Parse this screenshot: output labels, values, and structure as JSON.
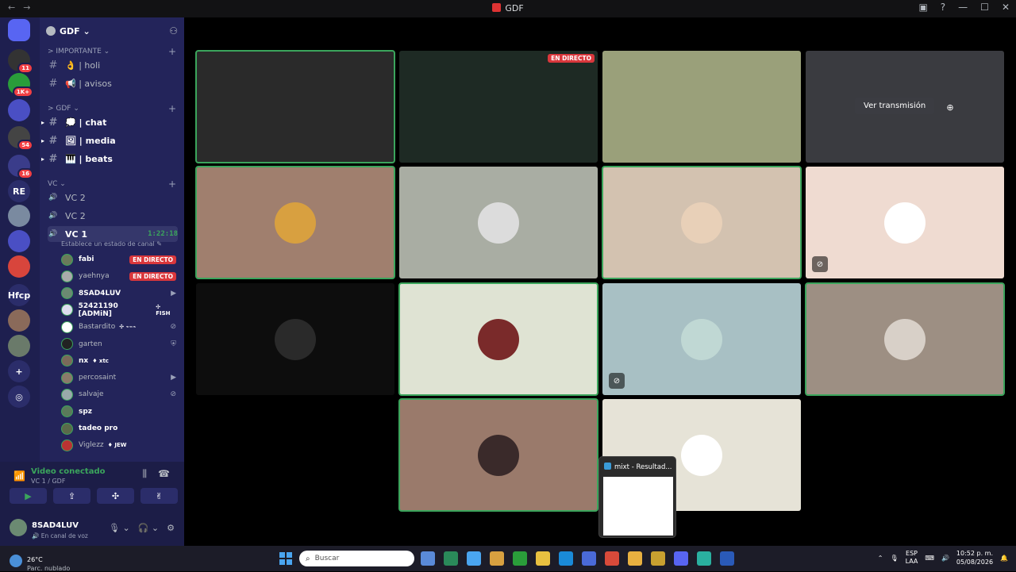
{
  "window": {
    "title": "GDF",
    "back": "←",
    "forward": "→",
    "icons": [
      "inbox-icon",
      "help-icon"
    ],
    "minimize": "—",
    "maximize": "☐",
    "close": "✕"
  },
  "servers": [
    {
      "label": "",
      "color": "#5865f2",
      "badge": ""
    },
    {
      "label": "",
      "color": "#333",
      "badge": "11"
    },
    {
      "label": "",
      "color": "#2a9d3a",
      "badge": "1K+"
    },
    {
      "label": "",
      "color": "#4a4fc4",
      "badge": ""
    },
    {
      "label": "",
      "color": "#444",
      "badge": "54"
    },
    {
      "label": "",
      "color": "#3a3c8a",
      "badge": "16"
    },
    {
      "label": "RE",
      "color": "#2b2d6a",
      "badge": ""
    },
    {
      "label": "",
      "color": "#7a8aa0",
      "badge": ""
    },
    {
      "label": "",
      "color": "#4a4fc4",
      "badge": ""
    },
    {
      "label": "",
      "color": "#d8453c",
      "badge": ""
    },
    {
      "label": "Hfcp",
      "color": "#2b2d6a",
      "badge": ""
    },
    {
      "label": "",
      "color": "#8a6a5a",
      "badge": ""
    },
    {
      "label": "",
      "color": "#6a7a6a",
      "badge": ""
    },
    {
      "label": "+",
      "color": "#2b2d6a",
      "badge": ""
    },
    {
      "label": "◎",
      "color": "#2b2d6a",
      "badge": ""
    }
  ],
  "guild": {
    "name": "GDF ⌄"
  },
  "categories": [
    {
      "label": "> IMPORTANTE ⌄",
      "plus": "+"
    },
    {
      "label": "> GDF ⌄",
      "plus": "+"
    },
    {
      "label": "VC ⌄",
      "plus": "+"
    }
  ],
  "channels": [
    {
      "icon": "#",
      "label": "👌 | holi"
    },
    {
      "icon": "#",
      "label": "📢 | avisos"
    },
    {
      "icon": "#",
      "label": "💭 | chat"
    },
    {
      "icon": "#",
      "label": "🖼 | media"
    },
    {
      "icon": "#",
      "label": "🎹 | beats"
    },
    {
      "icon": "🔊",
      "label": "VC 2"
    },
    {
      "icon": "🔊",
      "label": "VC 2"
    },
    {
      "icon": "🔊",
      "label": "VC 1",
      "time": "1:22:18"
    }
  ],
  "vc_status": "Establece un estado de canal ✎",
  "members": [
    {
      "name": "fabi",
      "bold": true,
      "live": "EN DIRECTO",
      "tag": "",
      "icon": "",
      "color": "#6a7a5a"
    },
    {
      "name": "yaehnya",
      "bold": false,
      "live": "EN DIRECTO",
      "tag": "",
      "icon": "",
      "color": "#aaa"
    },
    {
      "name": "8SAD4LUV",
      "bold": true,
      "live": "",
      "tag": "",
      "icon": "▶",
      "color": "#6b8a72"
    },
    {
      "name": "52421190 [ADMiN]",
      "bold": true,
      "live": "",
      "tag": "✣ FISH",
      "icon": "",
      "color": "#dde"
    },
    {
      "name": "Bastardito",
      "bold": false,
      "live": "",
      "tag": "✣ ⌁⌁⌁",
      "icon": "⊘",
      "color": "#fff"
    },
    {
      "name": "garten",
      "bold": false,
      "live": "",
      "tag": "",
      "icon": "⛨",
      "color": "#222"
    },
    {
      "name": "nx",
      "bold": true,
      "live": "",
      "tag": "♦ xtc",
      "icon": "",
      "color": "#7a6a5a"
    },
    {
      "name": "percosaint",
      "bold": false,
      "live": "",
      "tag": "",
      "icon": "▶",
      "color": "#8a7a6a"
    },
    {
      "name": "salvaje",
      "bold": false,
      "live": "",
      "tag": "",
      "icon": "⊘",
      "color": "#9aa"
    },
    {
      "name": "spz",
      "bold": true,
      "live": "",
      "tag": "",
      "icon": "",
      "color": "#5a7a5a"
    },
    {
      "name": "tadeo pro",
      "bold": true,
      "live": "",
      "tag": "",
      "icon": "",
      "color": "#5a6a4a"
    },
    {
      "name": "Viglezz",
      "bold": false,
      "live": "",
      "tag": "♦ JEW",
      "icon": "",
      "color": "#b33"
    }
  ],
  "voice": {
    "connected": "Video conectado",
    "location": "VC 1 / GDF",
    "buttons": [
      "▶",
      "⇪",
      "✣",
      "✌"
    ]
  },
  "user": {
    "name": "8SAD4LUV",
    "status": "🔊 En canal de voz"
  },
  "stage": {
    "live_badge": "EN DIRECTO",
    "watch": "Ver transmisión",
    "tiles": [
      {
        "bg": "#2a2a2a",
        "avatar": "",
        "speaking": true,
        "muted": false
      },
      {
        "bg": "#1e2a24",
        "avatar": "",
        "speaking": false,
        "muted": false,
        "live": true
      },
      {
        "bg": "#9aa07a",
        "avatar": "",
        "speaking": false,
        "muted": false
      },
      {
        "bg": "#3a3b40",
        "avatar": "",
        "speaking": false,
        "muted": false,
        "watch": true
      },
      {
        "bg": "#a07f6e",
        "avatar": "#d8a040",
        "speaking": true,
        "muted": false
      },
      {
        "bg": "#a9ada3",
        "avatar": "#dcdcdc",
        "speaking": false,
        "muted": false
      },
      {
        "bg": "#d3c2b0",
        "avatar": "#e8d0b8",
        "speaking": true,
        "muted": false
      },
      {
        "bg": "#efdbd1",
        "avatar": "#fff",
        "speaking": false,
        "muted": true
      },
      {
        "bg": "#0d0d0d",
        "avatar": "#2a2a2a",
        "speaking": false,
        "muted": false
      },
      {
        "bg": "#dfe3d3",
        "avatar": "#7a2a2a",
        "speaking": true,
        "muted": false
      },
      {
        "bg": "#a8c0c4",
        "avatar": "#c0d8d4",
        "speaking": false,
        "muted": true
      },
      {
        "bg": "#9d8f83",
        "avatar": "#d8d0c8",
        "speaking": true,
        "muted": false
      },
      {
        "bg": "#9a7a6b",
        "avatar": "#3a2a2a",
        "speaking": true,
        "muted": false
      },
      {
        "bg": "#e6e3d7",
        "avatar": "#fff",
        "speaking": false,
        "muted": false
      }
    ]
  },
  "thumbnail": {
    "label": "mixt - Resultad..."
  },
  "taskbar": {
    "temp": "26°C",
    "weather": "Parc. nublado",
    "search": "Buscar",
    "lang1": "ESP",
    "lang2": "LAA",
    "time": "10:52 p. m.",
    "date": "05/08/2026",
    "icons": [
      "#5a8ad8",
      "#2a8a5a",
      "#4aa5f0",
      "#d8a040",
      "#2a9d3a",
      "#e8c040",
      "#1a8ad8",
      "#4a6ad8",
      "#d84a3a",
      "#e8b040",
      "#c8a030",
      "#5865f2",
      "#2ab0a0",
      "#2a5ab8"
    ]
  }
}
